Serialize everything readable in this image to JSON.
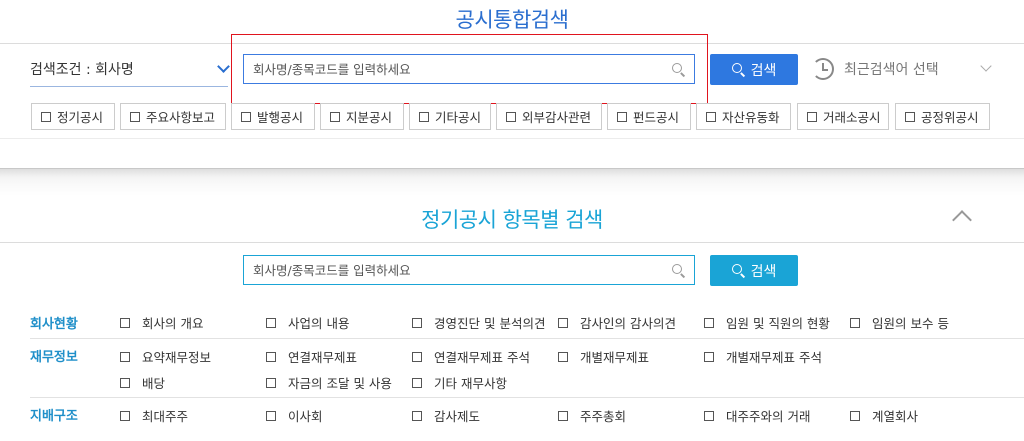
{
  "integrated_search": {
    "title": "공시통합검색",
    "condition_label": "검색조건 : 회사명",
    "search_placeholder": "회사명/종목코드를 입력하세요",
    "search_button": "검색",
    "recent_label": "최근검색어 선택",
    "filters": [
      "정기공시",
      "주요사항보고",
      "발행공시",
      "지분공시",
      "기타공시",
      "외부감사관련",
      "펀드공시",
      "자산유동화",
      "거래소공시",
      "공정위공시"
    ]
  },
  "item_search": {
    "title": "정기공시 항목별 검색",
    "search_placeholder": "회사명/종목코드를 입력하세요",
    "search_button": "검색",
    "categories": [
      {
        "label": "회사현황",
        "items": [
          "회사의 개요",
          "사업의 내용",
          "경영진단 및 분석의견",
          "감사인의 감사의견",
          "임원 및 직원의 현황",
          "임원의 보수 등"
        ]
      },
      {
        "label": "재무정보",
        "items": [
          "요약재무정보",
          "연결재무제표",
          "연결재무제표 주석",
          "개별재무제표",
          "개별재무제표 주석",
          "배당",
          "자금의 조달 및 사용",
          "기타 재무사항"
        ]
      },
      {
        "label": "지배구조",
        "items": [
          "최대주주",
          "이사회",
          "감사제도",
          "주주총회",
          "대주주와의 거래",
          "계열회사"
        ]
      }
    ]
  },
  "colors": {
    "primary_blue": "#2e78e0",
    "teal": "#1aa4d6",
    "highlight_red": "#e0141e"
  }
}
